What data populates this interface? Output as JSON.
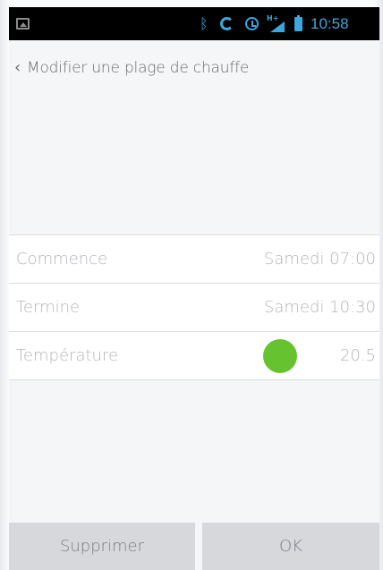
{
  "status_bar": {
    "time": "10:58",
    "network_label": "H+",
    "icons": [
      "image-icon",
      "bluetooth-icon",
      "sync-icon",
      "alarm-icon",
      "signal-icon",
      "battery-icon"
    ],
    "icon_color": "#3aa7e0"
  },
  "header": {
    "back_glyph": "‹",
    "title": "Modifier une plage de chauffe"
  },
  "rows": [
    {
      "label": "Commence",
      "value": "Samedi 07:00"
    },
    {
      "label": "Termine",
      "value": "Samedi 10:30"
    },
    {
      "label": "Température",
      "value": "20.5",
      "indicator_color": "#66c22e"
    }
  ],
  "actions": {
    "delete_label": "Supprimer",
    "ok_label": "OK"
  }
}
